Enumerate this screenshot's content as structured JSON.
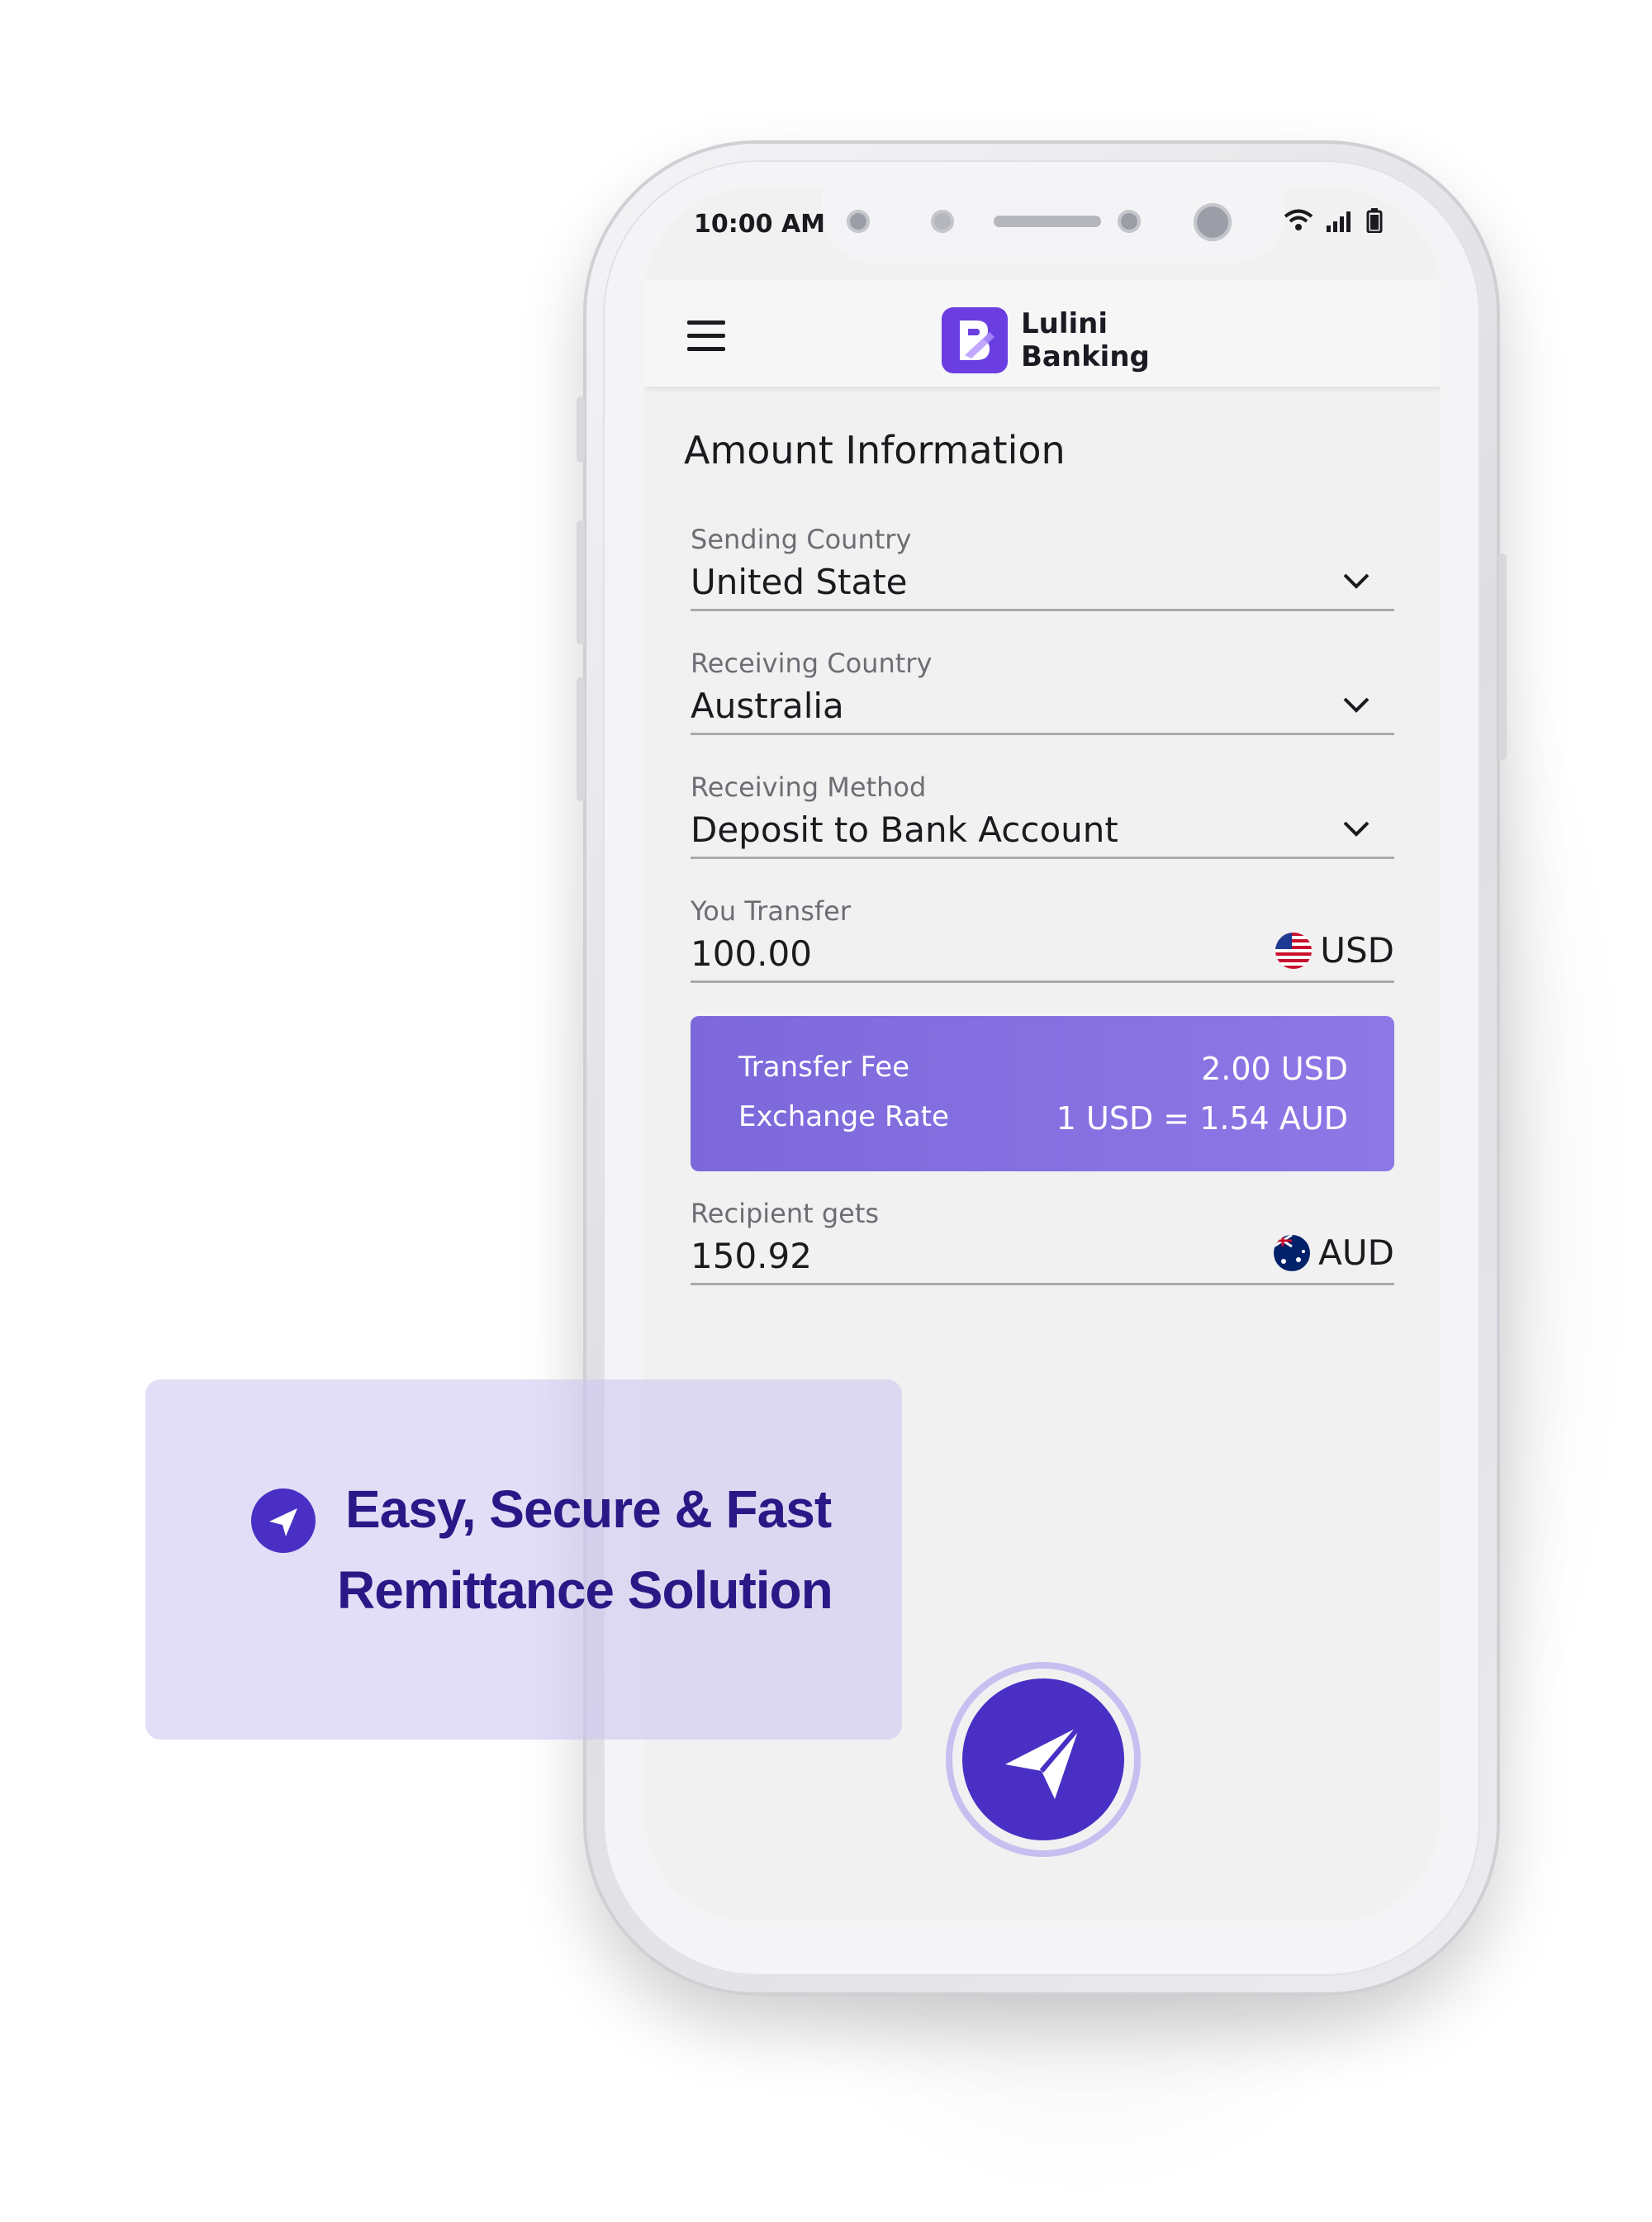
{
  "status_bar": {
    "time": "10:00 AM"
  },
  "app": {
    "brand_line1": "Lulini",
    "brand_line2": "Banking"
  },
  "form": {
    "title": "Amount Information",
    "sending_country": {
      "label": "Sending Country",
      "value": "United State"
    },
    "receiving_country": {
      "label": "Receiving Country",
      "value": "Australia"
    },
    "receiving_method": {
      "label": "Receiving Method",
      "value": "Deposit to Bank Account"
    },
    "you_transfer": {
      "label": "You Transfer",
      "value": "100.00",
      "currency": "USD"
    },
    "fees": {
      "transfer_fee_label": "Transfer Fee",
      "transfer_fee_value": "2.00 USD",
      "exchange_rate_label": "Exchange Rate",
      "exchange_rate_value": "1 USD = 1.54 AUD"
    },
    "recipient_gets": {
      "label": "Recipient gets",
      "value": "150.92",
      "currency": "AUD"
    }
  },
  "promo": {
    "line1": "Easy, Secure & Fast",
    "line2": "Remittance Solution"
  },
  "colors": {
    "accent": "#4a2fc4",
    "card": "#8570e0",
    "promo_text": "#2b1887"
  }
}
